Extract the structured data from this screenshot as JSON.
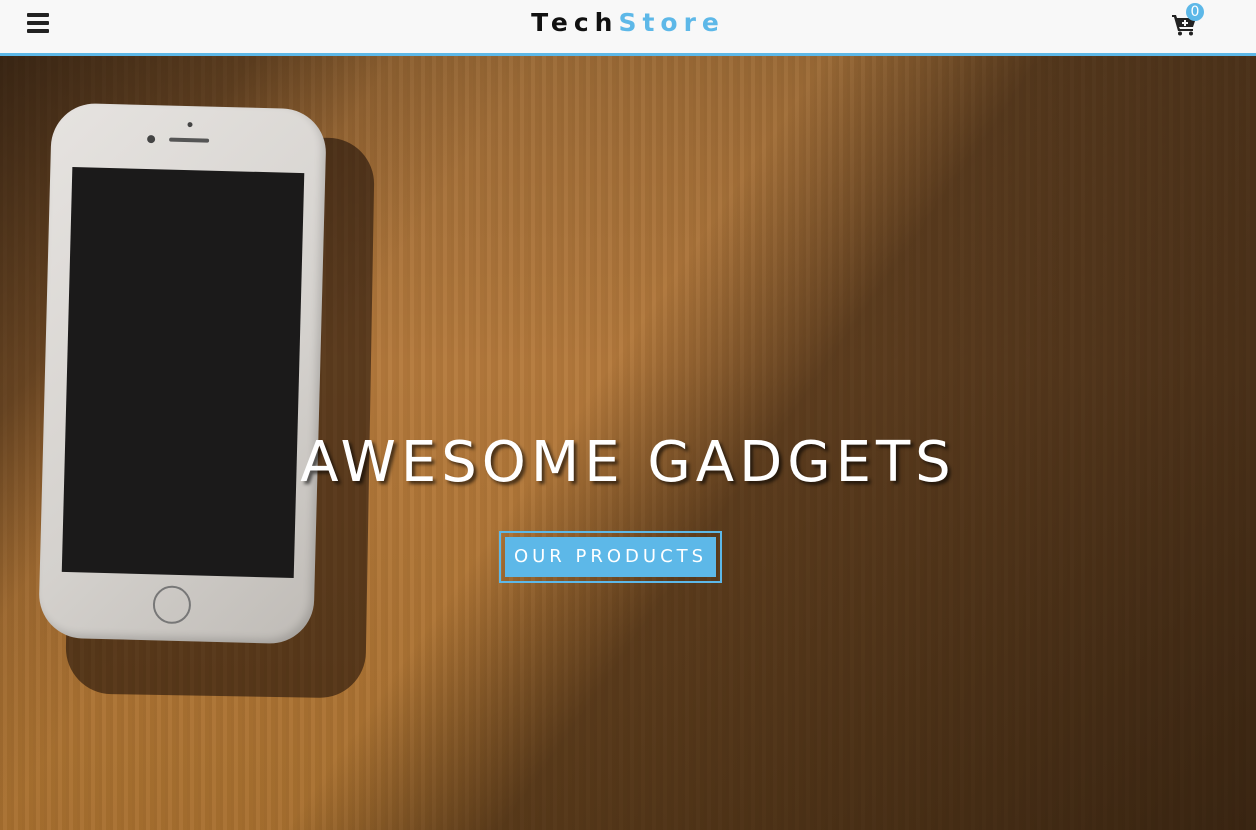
{
  "navbar": {
    "brand_part1": "Tech",
    "brand_part2": "Store",
    "menu_icon": "hamburger-menu-icon",
    "cart_icon": "shopping-cart-icon",
    "cart_count": "0"
  },
  "hero": {
    "title": "AWESOME GADGETS",
    "cta_label": "OUR PRODUCTS",
    "background_image": "smartphone on wooden table"
  },
  "colors": {
    "accent": "#5db8e8",
    "brand_dark": "#111111",
    "navbar_bg": "#f8f8f8",
    "cta_text": "#ffffff"
  }
}
